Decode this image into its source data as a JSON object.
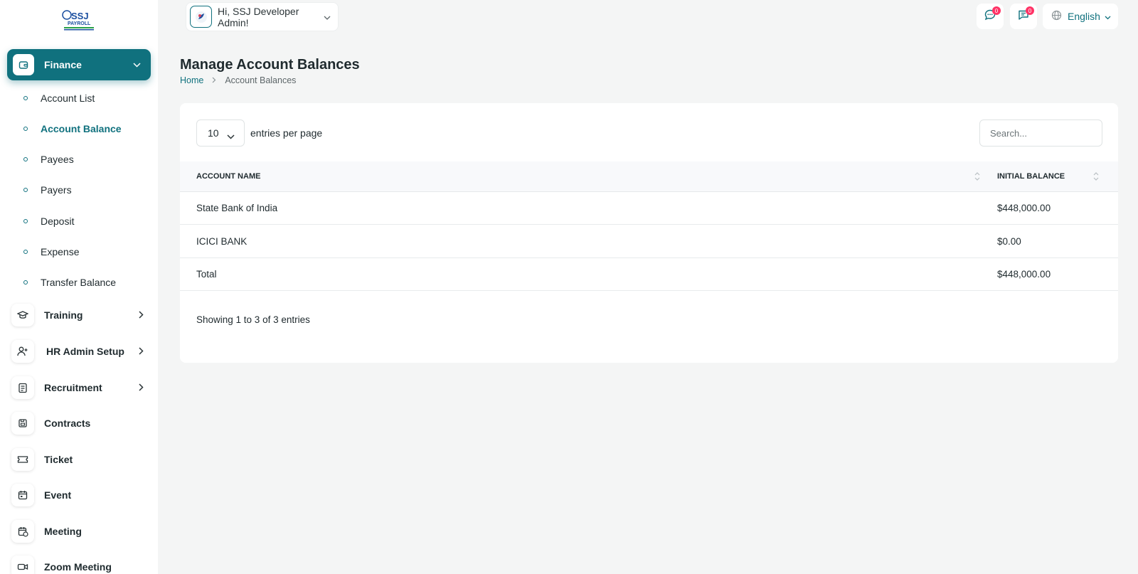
{
  "header": {
    "greeting": "Hi, SSJ Developer Admin!",
    "messages_badge": "0",
    "notes_badge": "0",
    "language": "English"
  },
  "sidebar": {
    "logo_label": "SSJ PAYROLL",
    "finance": {
      "label": "Finance",
      "subitems": [
        {
          "label": "Account List"
        },
        {
          "label": "Account Balance"
        },
        {
          "label": "Payees"
        },
        {
          "label": "Payers"
        },
        {
          "label": "Deposit"
        },
        {
          "label": "Expense"
        },
        {
          "label": "Transfer Balance"
        }
      ]
    },
    "items": [
      {
        "label": "Training"
      },
      {
        "label": "HR Admin Setup"
      },
      {
        "label": "Recruitment"
      },
      {
        "label": "Contracts"
      },
      {
        "label": "Ticket"
      },
      {
        "label": "Event"
      },
      {
        "label": "Meeting"
      },
      {
        "label": "Zoom Meeting"
      }
    ]
  },
  "page": {
    "title": "Manage Account Balances",
    "breadcrumb": {
      "home": "Home",
      "current": "Account Balances"
    }
  },
  "table": {
    "entries_value": "10",
    "entries_label": "entries per page",
    "search_placeholder": "Search...",
    "columns": [
      "ACCOUNT NAME",
      "INITIAL BALANCE"
    ],
    "rows": [
      {
        "name": "State Bank of India",
        "balance": "$448,000.00"
      },
      {
        "name": "ICICI BANK",
        "balance": "$0.00"
      },
      {
        "name": "Total",
        "balance": "$448,000.00"
      }
    ],
    "showing": "Showing 1 to 3 of 3 entries"
  },
  "colors": {
    "accent": "#10717e",
    "badge": "#ff3366"
  }
}
